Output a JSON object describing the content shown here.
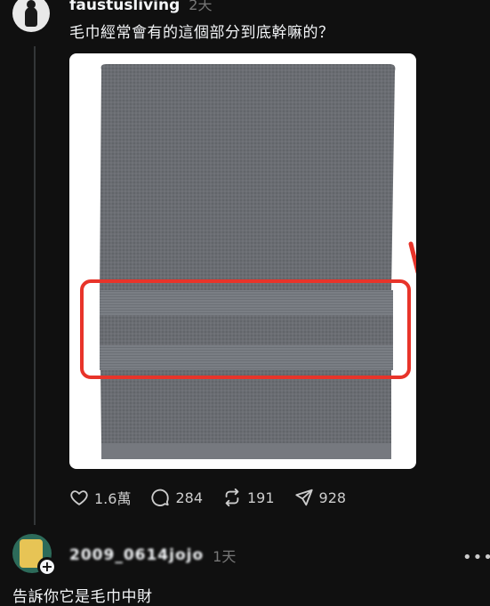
{
  "post": {
    "username": "faustusliving",
    "timestamp": "2天",
    "text": "毛巾經常會有的這個部分到底幹嘛的？",
    "image": {
      "towel_color": "#6a6d72",
      "highlight_color": "#e8342a"
    },
    "actions": {
      "likes": "1.6萬",
      "comments": "284",
      "reposts": "191",
      "shares": "928"
    }
  },
  "reply": {
    "username": "2009_0614jojo",
    "timestamp": "1天",
    "text": "告訴你它是毛巾中財",
    "more_label": "•••",
    "add_label": "+"
  },
  "colors": {
    "background": "#101010",
    "text": "#f3f5f7",
    "muted": "#777777"
  }
}
